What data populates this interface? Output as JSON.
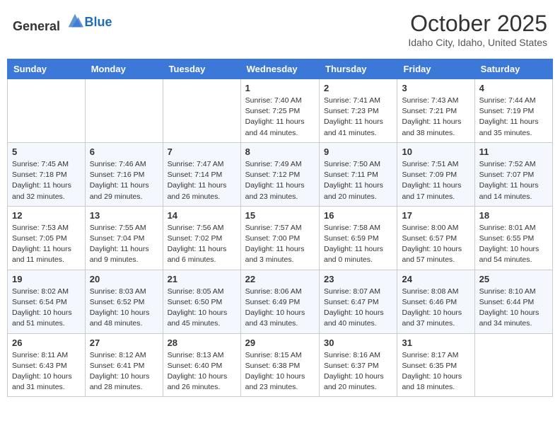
{
  "header": {
    "logo_general": "General",
    "logo_blue": "Blue",
    "month": "October 2025",
    "location": "Idaho City, Idaho, United States"
  },
  "weekdays": [
    "Sunday",
    "Monday",
    "Tuesday",
    "Wednesday",
    "Thursday",
    "Friday",
    "Saturday"
  ],
  "weeks": [
    [
      {
        "day": "",
        "info": ""
      },
      {
        "day": "",
        "info": ""
      },
      {
        "day": "",
        "info": ""
      },
      {
        "day": "1",
        "info": "Sunrise: 7:40 AM\nSunset: 7:25 PM\nDaylight: 11 hours and 44 minutes."
      },
      {
        "day": "2",
        "info": "Sunrise: 7:41 AM\nSunset: 7:23 PM\nDaylight: 11 hours and 41 minutes."
      },
      {
        "day": "3",
        "info": "Sunrise: 7:43 AM\nSunset: 7:21 PM\nDaylight: 11 hours and 38 minutes."
      },
      {
        "day": "4",
        "info": "Sunrise: 7:44 AM\nSunset: 7:19 PM\nDaylight: 11 hours and 35 minutes."
      }
    ],
    [
      {
        "day": "5",
        "info": "Sunrise: 7:45 AM\nSunset: 7:18 PM\nDaylight: 11 hours and 32 minutes."
      },
      {
        "day": "6",
        "info": "Sunrise: 7:46 AM\nSunset: 7:16 PM\nDaylight: 11 hours and 29 minutes."
      },
      {
        "day": "7",
        "info": "Sunrise: 7:47 AM\nSunset: 7:14 PM\nDaylight: 11 hours and 26 minutes."
      },
      {
        "day": "8",
        "info": "Sunrise: 7:49 AM\nSunset: 7:12 PM\nDaylight: 11 hours and 23 minutes."
      },
      {
        "day": "9",
        "info": "Sunrise: 7:50 AM\nSunset: 7:11 PM\nDaylight: 11 hours and 20 minutes."
      },
      {
        "day": "10",
        "info": "Sunrise: 7:51 AM\nSunset: 7:09 PM\nDaylight: 11 hours and 17 minutes."
      },
      {
        "day": "11",
        "info": "Sunrise: 7:52 AM\nSunset: 7:07 PM\nDaylight: 11 hours and 14 minutes."
      }
    ],
    [
      {
        "day": "12",
        "info": "Sunrise: 7:53 AM\nSunset: 7:05 PM\nDaylight: 11 hours and 11 minutes."
      },
      {
        "day": "13",
        "info": "Sunrise: 7:55 AM\nSunset: 7:04 PM\nDaylight: 11 hours and 9 minutes."
      },
      {
        "day": "14",
        "info": "Sunrise: 7:56 AM\nSunset: 7:02 PM\nDaylight: 11 hours and 6 minutes."
      },
      {
        "day": "15",
        "info": "Sunrise: 7:57 AM\nSunset: 7:00 PM\nDaylight: 11 hours and 3 minutes."
      },
      {
        "day": "16",
        "info": "Sunrise: 7:58 AM\nSunset: 6:59 PM\nDaylight: 11 hours and 0 minutes."
      },
      {
        "day": "17",
        "info": "Sunrise: 8:00 AM\nSunset: 6:57 PM\nDaylight: 10 hours and 57 minutes."
      },
      {
        "day": "18",
        "info": "Sunrise: 8:01 AM\nSunset: 6:55 PM\nDaylight: 10 hours and 54 minutes."
      }
    ],
    [
      {
        "day": "19",
        "info": "Sunrise: 8:02 AM\nSunset: 6:54 PM\nDaylight: 10 hours and 51 minutes."
      },
      {
        "day": "20",
        "info": "Sunrise: 8:03 AM\nSunset: 6:52 PM\nDaylight: 10 hours and 48 minutes."
      },
      {
        "day": "21",
        "info": "Sunrise: 8:05 AM\nSunset: 6:50 PM\nDaylight: 10 hours and 45 minutes."
      },
      {
        "day": "22",
        "info": "Sunrise: 8:06 AM\nSunset: 6:49 PM\nDaylight: 10 hours and 43 minutes."
      },
      {
        "day": "23",
        "info": "Sunrise: 8:07 AM\nSunset: 6:47 PM\nDaylight: 10 hours and 40 minutes."
      },
      {
        "day": "24",
        "info": "Sunrise: 8:08 AM\nSunset: 6:46 PM\nDaylight: 10 hours and 37 minutes."
      },
      {
        "day": "25",
        "info": "Sunrise: 8:10 AM\nSunset: 6:44 PM\nDaylight: 10 hours and 34 minutes."
      }
    ],
    [
      {
        "day": "26",
        "info": "Sunrise: 8:11 AM\nSunset: 6:43 PM\nDaylight: 10 hours and 31 minutes."
      },
      {
        "day": "27",
        "info": "Sunrise: 8:12 AM\nSunset: 6:41 PM\nDaylight: 10 hours and 28 minutes."
      },
      {
        "day": "28",
        "info": "Sunrise: 8:13 AM\nSunset: 6:40 PM\nDaylight: 10 hours and 26 minutes."
      },
      {
        "day": "29",
        "info": "Sunrise: 8:15 AM\nSunset: 6:38 PM\nDaylight: 10 hours and 23 minutes."
      },
      {
        "day": "30",
        "info": "Sunrise: 8:16 AM\nSunset: 6:37 PM\nDaylight: 10 hours and 20 minutes."
      },
      {
        "day": "31",
        "info": "Sunrise: 8:17 AM\nSunset: 6:35 PM\nDaylight: 10 hours and 18 minutes."
      },
      {
        "day": "",
        "info": ""
      }
    ]
  ]
}
